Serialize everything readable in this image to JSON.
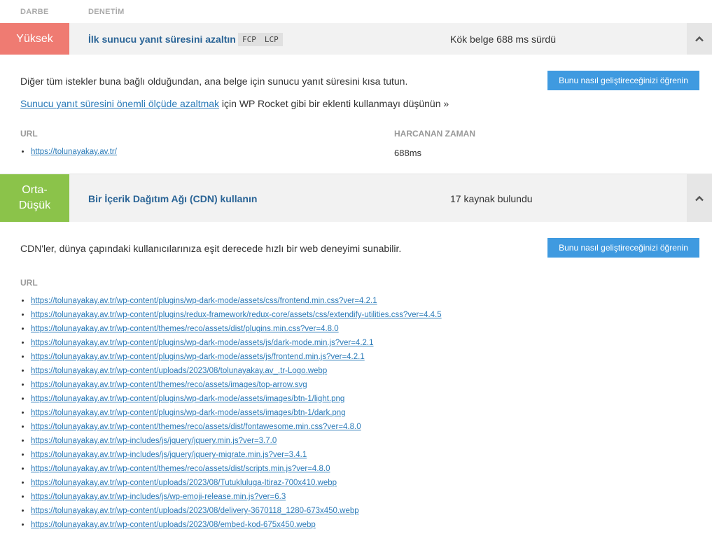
{
  "headers": {
    "impact": "DARBE",
    "audit": "DENETİM"
  },
  "audit1": {
    "impact": "Yüksek",
    "title": "İlk sunucu yanıt süresini azaltın",
    "tags": [
      "FCP",
      "LCP"
    ],
    "summary": "Kök belge 688 ms sürdü",
    "description": "Diğer tüm istekler buna bağlı olduğundan, ana belge için sunucu yanıt süresini kısa tutun.",
    "learn_button": "Bunu nasıl geliştireceğinizi öğrenin",
    "hint_link": "Sunucu yanıt süresini önemli ölçüde azaltmak",
    "hint_text": " için WP Rocket gibi bir eklenti kullanmayı düşünün »",
    "col_url": "URL",
    "col_time": "HARCANAN ZAMAN",
    "rows": [
      {
        "url": "https://tolunayakay.av.tr/",
        "time": "688ms"
      }
    ]
  },
  "audit2": {
    "impact_line1": "Orta-",
    "impact_line2": "Düşük",
    "title": "Bir İçerik Dağıtım Ağı (CDN) kullanın",
    "summary": "17 kaynak bulundu",
    "description": "CDN'ler, dünya çapındaki kullanıcılarınıza eşit derecede hızlı bir web deneyimi sunabilir.",
    "learn_button": "Bunu nasıl geliştireceğinizi öğrenin",
    "col_url": "URL",
    "urls": [
      "https://tolunayakay.av.tr/wp-content/plugins/wp-dark-mode/assets/css/frontend.min.css?ver=4.2.1",
      "https://tolunayakay.av.tr/wp-content/plugins/redux-framework/redux-core/assets/css/extendify-utilities.css?ver=4.4.5",
      "https://tolunayakay.av.tr/wp-content/themes/reco/assets/dist/plugins.min.css?ver=4.8.0",
      "https://tolunayakay.av.tr/wp-content/plugins/wp-dark-mode/assets/js/dark-mode.min.js?ver=4.2.1",
      "https://tolunayakay.av.tr/wp-content/plugins/wp-dark-mode/assets/js/frontend.min.js?ver=4.2.1",
      "https://tolunayakay.av.tr/wp-content/uploads/2023/08/tolunayakay.av_.tr-Logo.webp",
      "https://tolunayakay.av.tr/wp-content/themes/reco/assets/images/top-arrow.svg",
      "https://tolunayakay.av.tr/wp-content/plugins/wp-dark-mode/assets/images/btn-1/light.png",
      "https://tolunayakay.av.tr/wp-content/plugins/wp-dark-mode/assets/images/btn-1/dark.png",
      "https://tolunayakay.av.tr/wp-content/themes/reco/assets/dist/fontawesome.min.css?ver=4.8.0",
      "https://tolunayakay.av.tr/wp-includes/js/jquery/jquery.min.js?ver=3.7.0",
      "https://tolunayakay.av.tr/wp-includes/js/jquery/jquery-migrate.min.js?ver=3.4.1",
      "https://tolunayakay.av.tr/wp-content/themes/reco/assets/dist/scripts.min.js?ver=4.8.0",
      "https://tolunayakay.av.tr/wp-content/uploads/2023/08/Tutukluluga-Itiraz-700x410.webp",
      "https://tolunayakay.av.tr/wp-includes/js/wp-emoji-release.min.js?ver=6.3",
      "https://tolunayakay.av.tr/wp-content/uploads/2023/08/delivery-3670118_1280-673x450.webp",
      "https://tolunayakay.av.tr/wp-content/uploads/2023/08/embed-kod-675x450.webp"
    ]
  },
  "colors": {
    "high": "#ef7b72",
    "medium_low": "#8bc34a",
    "button": "#3f9ae0",
    "link": "#2a7ab8",
    "title": "#2a6496"
  },
  "icons": {
    "toggle": "chevron-up-icon"
  }
}
